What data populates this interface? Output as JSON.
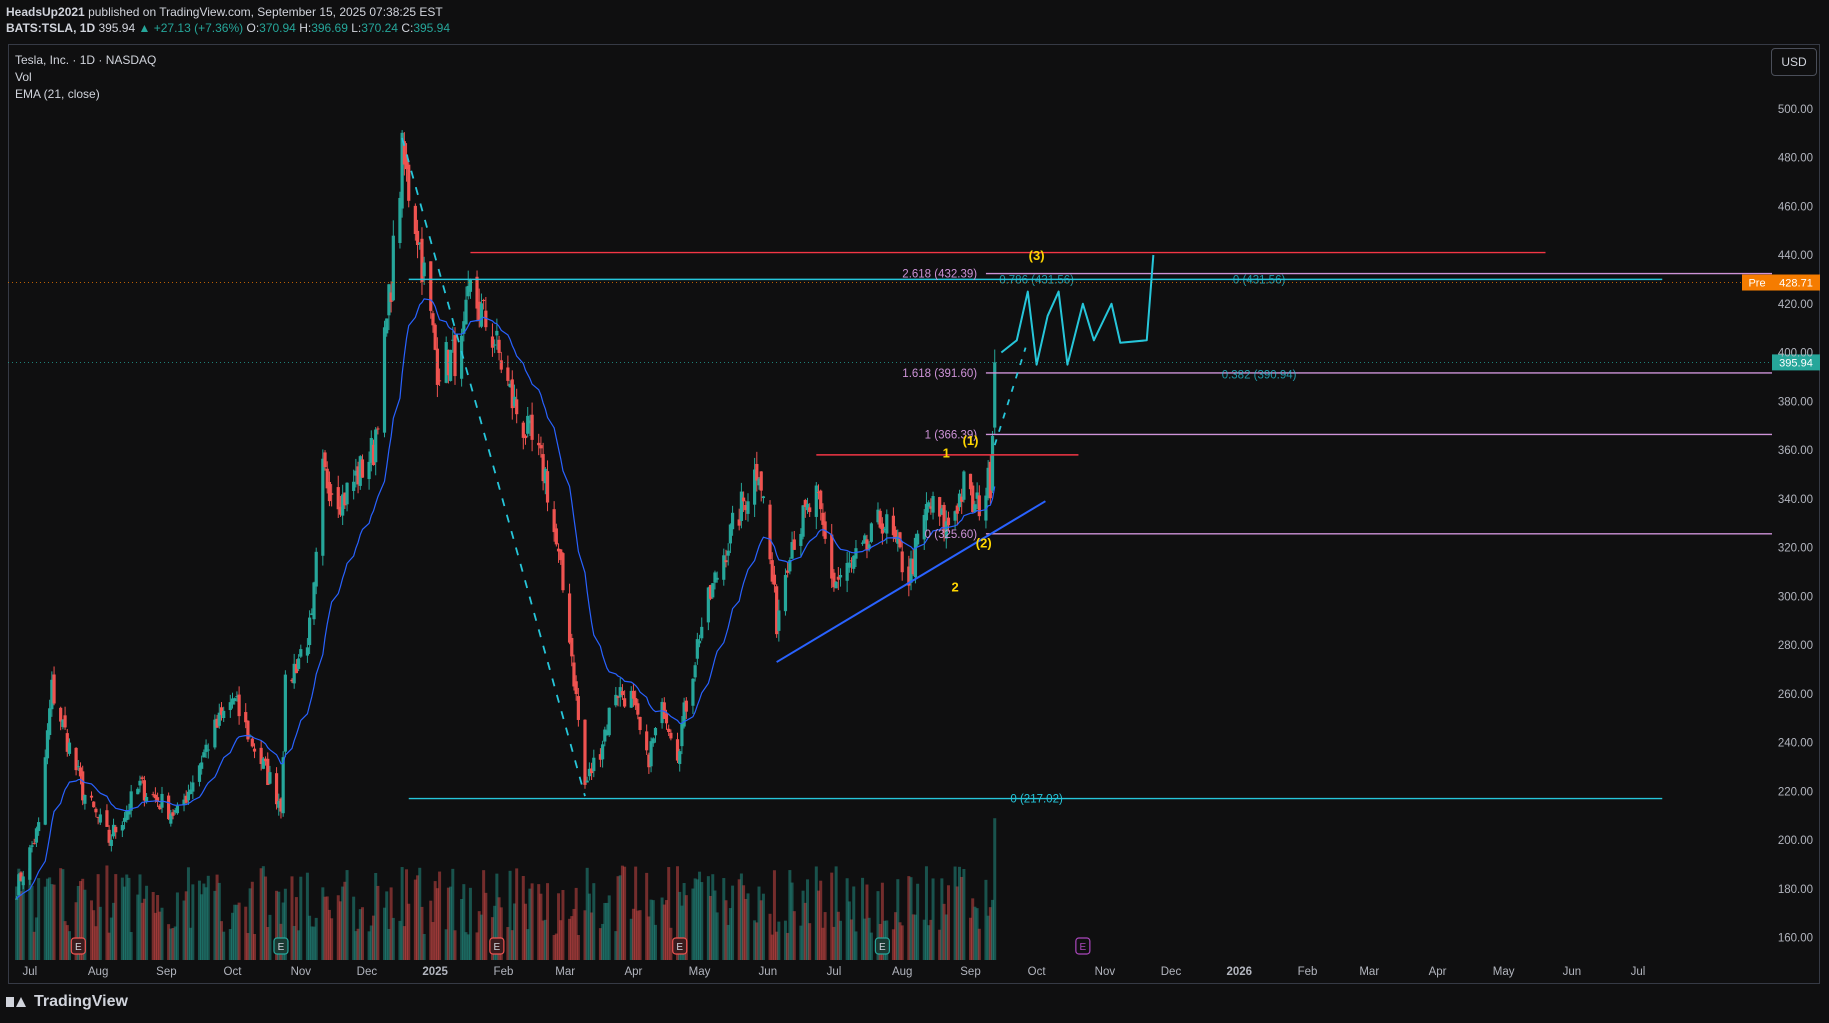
{
  "header": {
    "author": "HeadsUp2021",
    "published": "published on TradingView.com, September 15, 2025 07:38:25 EST",
    "symbol": "BATS:TSLA, 1D",
    "last": "395.94",
    "change": "+27.13 (+7.36%)",
    "o_label": "O:",
    "o": "370.94",
    "h_label": "H:",
    "h": "396.69",
    "l_label": "L:",
    "l": "370.24",
    "c_label": "C:",
    "c": "395.94"
  },
  "legend": {
    "title": "Tesla, Inc. · 1D · NASDAQ",
    "vol": "Vol",
    "ema": "EMA (21, close)"
  },
  "currency_button": "USD",
  "footer_brand": "TradingView",
  "colors": {
    "up": "#26a69a",
    "down": "#ef5350",
    "ema": "#2962ff",
    "fib_violet": "#ce93d8",
    "red_line": "#f23645",
    "teal_line": "#26c6da",
    "yellow": "#ffd600",
    "pre_badge": "#f57c00",
    "last_badge": "#26a69a",
    "trend_line": "#2962ff"
  },
  "chart_data": {
    "type": "candlestick",
    "title": "Tesla, Inc. · 1D · NASDAQ",
    "ylim": [
      150,
      520
    ],
    "y_ticks": [
      "160.00",
      "180.00",
      "200.00",
      "220.00",
      "240.00",
      "260.00",
      "280.00",
      "300.00",
      "320.00",
      "340.00",
      "360.00",
      "380.00",
      "400.00",
      "420.00",
      "440.00",
      "460.00",
      "480.00",
      "500.00"
    ],
    "x_ticks": [
      "Jul",
      "Aug",
      "Sep",
      "Oct",
      "Nov",
      "Dec",
      "2025",
      "Feb",
      "Mar",
      "Apr",
      "May",
      "Jun",
      "Jul",
      "Aug",
      "Sep",
      "Oct",
      "Nov",
      "Dec",
      "2026",
      "Feb",
      "Mar",
      "Apr",
      "May",
      "Jun",
      "Jul"
    ],
    "price_anchors": [
      [
        "2024-06-25",
        180
      ],
      [
        "2024-07-05",
        205
      ],
      [
        "2024-07-11",
        262
      ],
      [
        "2024-07-25",
        220
      ],
      [
        "2024-08-06",
        200
      ],
      [
        "2024-08-20",
        222
      ],
      [
        "2024-09-06",
        210
      ],
      [
        "2024-09-20",
        240
      ],
      [
        "2024-10-01",
        258
      ],
      [
        "2024-10-10",
        240
      ],
      [
        "2024-10-23",
        215
      ],
      [
        "2024-10-25",
        262
      ],
      [
        "2024-11-06",
        288
      ],
      [
        "2024-11-11",
        350
      ],
      [
        "2024-11-20",
        340
      ],
      [
        "2024-12-04",
        360
      ],
      [
        "2024-12-11",
        420
      ],
      [
        "2024-12-17",
        480
      ],
      [
        "2024-12-24",
        450
      ],
      [
        "2025-01-02",
        395
      ],
      [
        "2025-01-13",
        400
      ],
      [
        "2025-01-17",
        425
      ],
      [
        "2025-01-28",
        405
      ],
      [
        "2025-02-05",
        380
      ],
      [
        "2025-02-20",
        350
      ],
      [
        "2025-03-03",
        285
      ],
      [
        "2025-03-10",
        222
      ],
      [
        "2025-03-17",
        238
      ],
      [
        "2025-03-24",
        262
      ],
      [
        "2025-03-31",
        258
      ],
      [
        "2025-04-07",
        232
      ],
      [
        "2025-04-15",
        255
      ],
      [
        "2025-04-21",
        237
      ],
      [
        "2025-05-01",
        285
      ],
      [
        "2025-05-12",
        318
      ],
      [
        "2025-05-28",
        355
      ],
      [
        "2025-06-05",
        290
      ],
      [
        "2025-06-11",
        322
      ],
      [
        "2025-06-23",
        340
      ],
      [
        "2025-07-01",
        305
      ],
      [
        "2025-07-15",
        318
      ],
      [
        "2025-07-23",
        332
      ],
      [
        "2025-08-04",
        308
      ],
      [
        "2025-08-13",
        338
      ],
      [
        "2025-08-21",
        328
      ],
      [
        "2025-08-29",
        345
      ],
      [
        "2025-09-03",
        335
      ],
      [
        "2025-09-10",
        348
      ],
      [
        "2025-09-12",
        395.94
      ]
    ],
    "ema": {
      "name": "EMA (21, close)"
    },
    "volume": {
      "name": "Vol"
    },
    "last_price": 395.94,
    "pre_market": {
      "label": "Pre",
      "value": 428.71
    },
    "fib_extension_labels": [
      {
        "text": "2.618 (432.39)",
        "value": 432.39
      },
      {
        "text": "1.618 (391.60)",
        "value": 391.6
      },
      {
        "text": "1 (366.39)",
        "value": 366.39
      },
      {
        "text": "0 (325.60)",
        "value": 325.6
      }
    ],
    "fib_retracement_labels": [
      {
        "text": "0.786 (431.56)",
        "value": 431.56
      },
      {
        "text": "0 (431.56)",
        "value": 431.56
      },
      {
        "text": "0.382 (390.94)",
        "value": 390.94
      },
      {
        "text": "0 (217.02)",
        "value": 217.02
      }
    ],
    "horizontal_lines": [
      {
        "value": 441,
        "color": "red",
        "from": "2025-01-17",
        "to": "2026-05-20"
      },
      {
        "value": 358,
        "color": "red",
        "from": "2025-06-23",
        "to": "2025-10-20"
      },
      {
        "value": 430,
        "color": "teal",
        "from": "2024-12-20",
        "to": "2026-07-12"
      },
      {
        "value": 217.02,
        "color": "teal",
        "from": "2024-12-20",
        "to": "2026-07-12"
      }
    ],
    "wave_labels": [
      {
        "text": "(3)",
        "date": "2025-10-01",
        "value": 438
      },
      {
        "text": "(1)",
        "date": "2025-09-01",
        "value": 362
      },
      {
        "text": "(2)",
        "date": "2025-09-07",
        "value": 320
      },
      {
        "text": "1",
        "date": "2025-08-21",
        "value": 357
      },
      {
        "text": "2",
        "date": "2025-08-25",
        "value": 302
      }
    ],
    "trendline": {
      "from": [
        "2025-06-05",
        273
      ],
      "to": [
        "2025-10-05",
        339
      ]
    },
    "earnings_markers": [
      "E",
      "E",
      "E",
      "E",
      "E",
      "E"
    ],
    "projection_path": [
      [
        "2025-09-15",
        400
      ],
      [
        "2025-09-22",
        405
      ],
      [
        "2025-09-27",
        425
      ],
      [
        "2025-10-01",
        395
      ],
      [
        "2025-10-06",
        415
      ],
      [
        "2025-10-11",
        425
      ],
      [
        "2025-10-15",
        395
      ],
      [
        "2025-10-22",
        420
      ],
      [
        "2025-10-27",
        405
      ],
      [
        "2025-11-04",
        420
      ],
      [
        "2025-11-08",
        404
      ],
      [
        "2025-11-20",
        405
      ],
      [
        "2025-11-23",
        440
      ]
    ]
  }
}
